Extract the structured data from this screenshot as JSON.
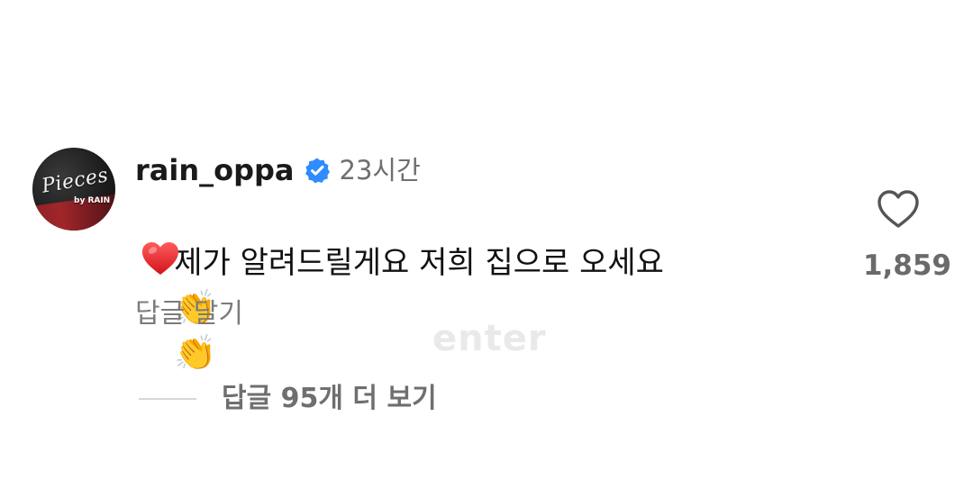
{
  "comment": {
    "username": "rain_oppa",
    "time": "23시간",
    "text": "제가 알려드릴게요 저희 집으로 오세요",
    "reactions": [
      "👏",
      "👏"
    ],
    "reply_label": "답글 달기",
    "likes": "1,859",
    "view_replies_label": "답글 95개 더 보기",
    "avatar_logo_text": "Pieces",
    "avatar_logo_sub": "by RAIN"
  },
  "overlay": {
    "watermark": "enter"
  },
  "colors": {
    "verified_blue": "#2f8cff",
    "heart_red": "#e22227",
    "muted_text": "#7b7b7b"
  }
}
